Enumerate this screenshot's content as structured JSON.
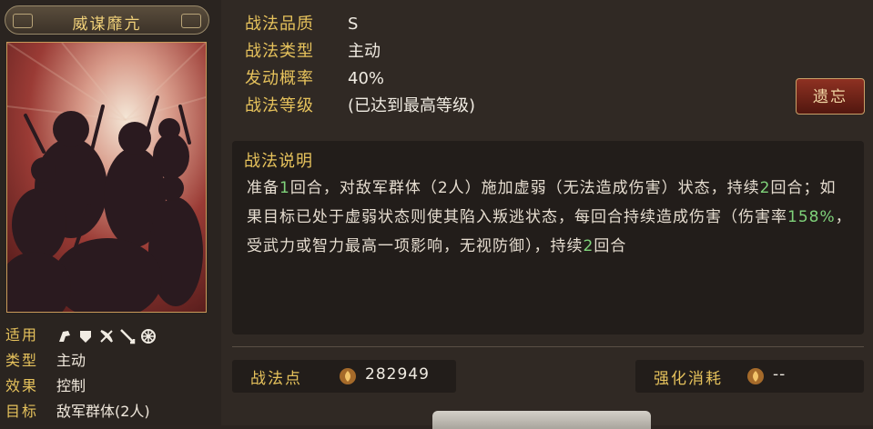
{
  "skill": {
    "name": "威谋靡亢",
    "properties": [
      {
        "key": "适用",
        "value": "",
        "icons": [
          "cavalry-icon",
          "shield-icon",
          "bow-icon",
          "spear-icon",
          "wheel-icon"
        ]
      },
      {
        "key": "类型",
        "value": "主动"
      },
      {
        "key": "效果",
        "value": "控制"
      },
      {
        "key": "目标",
        "value": "敌军群体(2人)"
      }
    ],
    "details": [
      {
        "label": "战法品质",
        "value": "S"
      },
      {
        "label": "战法类型",
        "value": "主动"
      },
      {
        "label": "发动概率",
        "value": "40%"
      },
      {
        "label": "战法等级",
        "value": "(已达到最高等级)"
      }
    ],
    "forget_label": "遗忘",
    "description_title": "战法说明",
    "description": [
      {
        "text": "准备",
        "hl": false
      },
      {
        "text": "1",
        "hl": true
      },
      {
        "text": "回合，对敌军群体（2人）施加虚弱（无法造成伤害）状态，持续",
        "hl": false
      },
      {
        "text": "2",
        "hl": true
      },
      {
        "text": "回合；如果目标已处于虚弱状态则使其陷入叛逃状态，每回合持续造成伤害（伤害率",
        "hl": false
      },
      {
        "text": "158%",
        "hl": true
      },
      {
        "text": "，受武力或智力最高一项影响，无视防御），持续",
        "hl": false
      },
      {
        "text": "2",
        "hl": true
      },
      {
        "text": "回合",
        "hl": false
      }
    ]
  },
  "footer": {
    "points_label": "战法点",
    "points_value": "282949",
    "cost_label": "强化消耗",
    "cost_value": "--"
  },
  "colors": {
    "accent": "#e6c25c",
    "highlight": "#7fd27a",
    "forget_button": "#8e3122"
  }
}
